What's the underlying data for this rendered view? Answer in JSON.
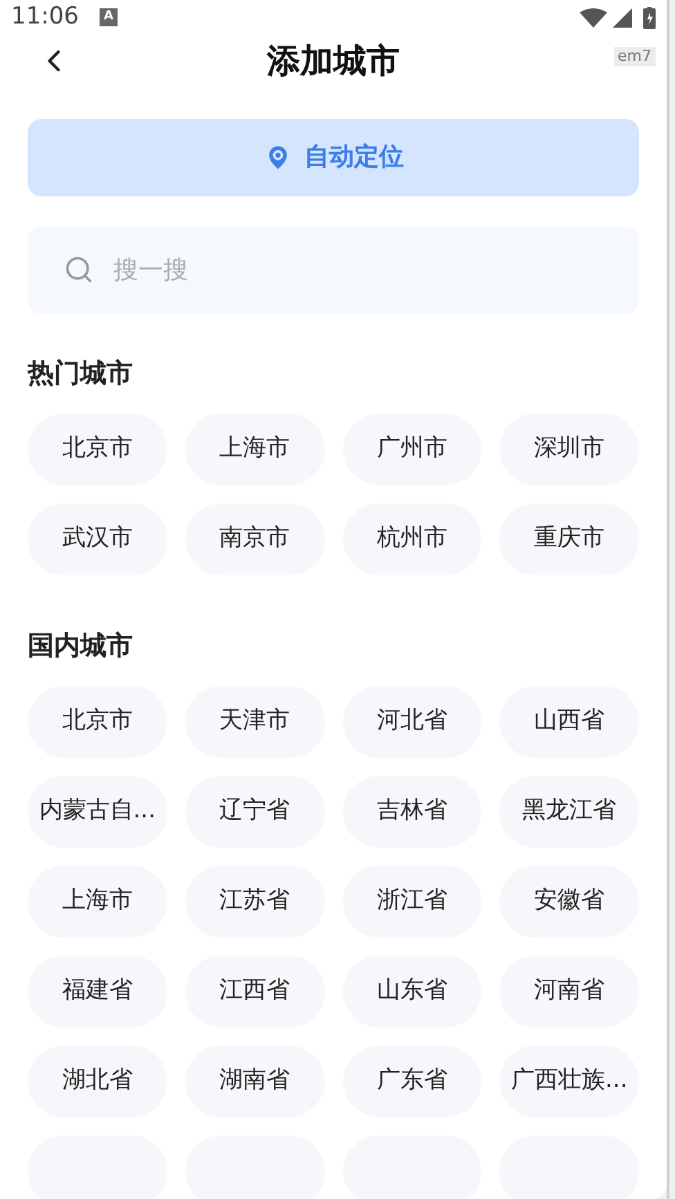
{
  "status_bar": {
    "time": "11:06",
    "notification": "A"
  },
  "debug_tag": "em7",
  "header": {
    "title": "添加城市"
  },
  "locate_button": {
    "label": "自动定位"
  },
  "search": {
    "placeholder": "搜一搜"
  },
  "sections": [
    {
      "title": "热门城市",
      "cities": [
        "北京市",
        "上海市",
        "广州市",
        "深圳市",
        "武汉市",
        "南京市",
        "杭州市",
        "重庆市"
      ]
    },
    {
      "title": "国内城市",
      "cities": [
        "北京市",
        "天津市",
        "河北省",
        "山西省",
        "内蒙古自...",
        "辽宁省",
        "吉林省",
        "黑龙江省",
        "上海市",
        "江苏省",
        "浙江省",
        "安徽省",
        "福建省",
        "江西省",
        "山东省",
        "河南省",
        "湖北省",
        "湖南省",
        "广东省",
        "广西壮族..."
      ]
    }
  ]
}
